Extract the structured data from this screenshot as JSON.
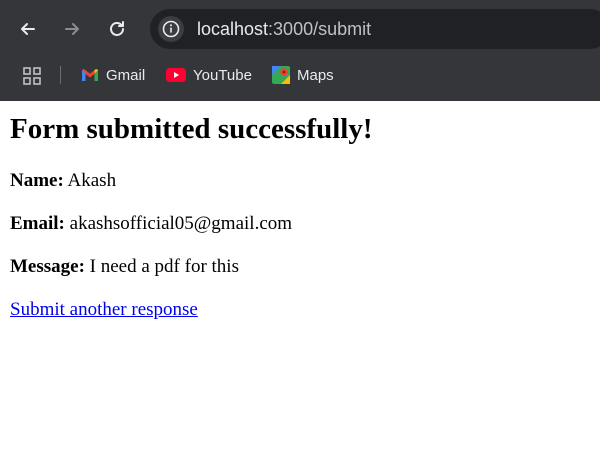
{
  "browser": {
    "url_host": "localhost",
    "url_rest": ":3000/submit",
    "bookmarks": [
      {
        "label": "Gmail",
        "icon": "gmail-icon"
      },
      {
        "label": "YouTube",
        "icon": "youtube-icon"
      },
      {
        "label": "Maps",
        "icon": "maps-icon"
      }
    ]
  },
  "page": {
    "heading": "Form submitted successfully!",
    "name_label": "Name:",
    "name_value": "Akash",
    "email_label": "Email:",
    "email_value": "akashsofficial05@gmail.com",
    "message_label": "Message:",
    "message_value": "I need a pdf for this",
    "link_text": "Submit another response"
  },
  "colors": {
    "chrome_bg": "#35363a",
    "omnibox_bg": "#202124",
    "link": "#0000ee"
  }
}
